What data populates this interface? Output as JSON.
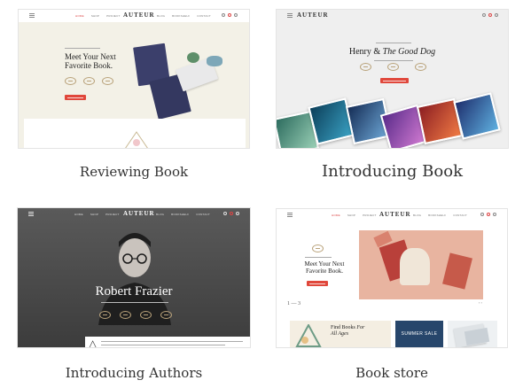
{
  "cards": [
    {
      "caption": "Reviewing Book",
      "preview": {
        "logo": "AUTEUR",
        "nav": [
          "HOME",
          "SHOP",
          "PROJECT",
          "BLOG",
          "BOOKSHELF",
          "CONTACT"
        ],
        "headline_line1": "Meet Your Next",
        "headline_line2": "Favorite Book."
      }
    },
    {
      "caption": "Introducing Book",
      "preview": {
        "logo": "AUTEUR",
        "headline_part1": "Henry & ",
        "headline_part2": "The Good Dog"
      }
    },
    {
      "caption": "Introducing Authors",
      "preview": {
        "logo": "AUTEUR",
        "nav": [
          "HOME",
          "SHOP",
          "PROJECT",
          "BLOG",
          "BOOKSHELF",
          "CONTACT"
        ],
        "author_name": "Robert Frazier"
      }
    },
    {
      "caption": "Book store",
      "preview": {
        "logo": "AUTEUR",
        "nav": [
          "HOME",
          "SHOP",
          "PROJECT",
          "BLOG",
          "BOOKSHELF",
          "CONTACT"
        ],
        "headline_line1": "Meet Your Next",
        "headline_line2": "Favorite Book.",
        "pager": "1 — 3",
        "find_part1": "Find Books ",
        "find_part2": "For",
        "find_line2": "All Ages",
        "sale_label": "SUMMER SALE"
      }
    }
  ],
  "colors": {
    "accent": "#e0473b",
    "cream": "#f3f1e7",
    "navy": "#27466b",
    "peach": "#e8b4a0"
  }
}
